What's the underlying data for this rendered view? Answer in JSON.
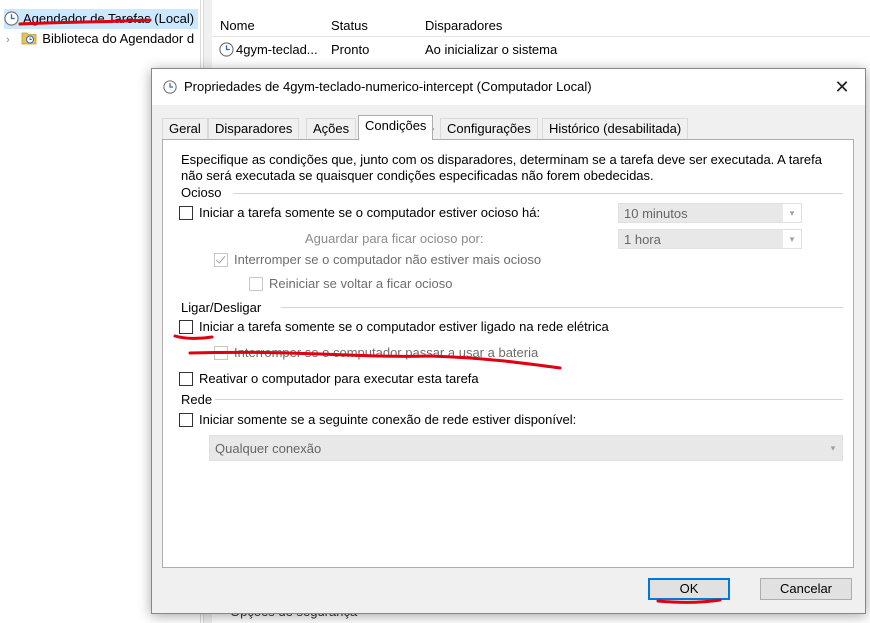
{
  "background": {
    "tree": {
      "root_label": "Agendador de Tarefas (Local)",
      "library_label": "Biblioteca do Agendador d"
    },
    "list": {
      "columns": [
        "Nome",
        "Status",
        "Disparadores"
      ],
      "row": {
        "name": "4gym-teclad...",
        "status": "Pronto",
        "trigger": "Ao inicializar o sistema"
      }
    },
    "bottom_text": "Opções de segurança"
  },
  "dialog": {
    "title": "Propriedades de 4gym-teclado-numerico-intercept (Computador Local)",
    "close_glyph": "✕",
    "tabs": [
      "Geral",
      "Disparadores",
      "Ações",
      "Condições",
      "Configurações",
      "Histórico (desabilitada)"
    ],
    "active_tab": "Condições",
    "description": "Especifique as condições que, junto com os disparadores, determinam se a tarefa deve ser executada. A tarefa não será executada se quaisquer condições especificadas não forem obedecidas.",
    "idle": {
      "label": "Ocioso",
      "start_if_idle": {
        "label": "Iniciar a tarefa somente se o computador estiver ocioso há:",
        "checked": false
      },
      "idle_for_value": "10 minutos",
      "wait_label": "Aguardar para ficar ocioso por:",
      "wait_value": "1 hora",
      "stop_if_not_idle": {
        "label": "Interromper se o computador não estiver mais ocioso",
        "checked": true
      },
      "restart_if_idle": {
        "label": "Reiniciar se voltar a ficar ocioso",
        "checked": false
      }
    },
    "power": {
      "label": "Ligar/Desligar",
      "start_on_ac": {
        "label": "Iniciar a tarefa somente se o computador estiver ligado na rede elétrica",
        "checked": false
      },
      "stop_on_battery": {
        "label": "Interromper se o computador passar a usar a bateria",
        "checked": false
      },
      "wake": {
        "label": "Reativar o computador para executar esta tarefa",
        "checked": false
      }
    },
    "network": {
      "label": "Rede",
      "start_if_network": {
        "label": "Iniciar somente se a seguinte conexão de rede estiver disponível:",
        "checked": false
      },
      "connection_value": "Qualquer conexão"
    },
    "buttons": {
      "ok": "OK",
      "cancel": "Cancelar"
    }
  },
  "colors": {
    "annotation": "#e0000f",
    "focus_blue": "#0078d7"
  }
}
